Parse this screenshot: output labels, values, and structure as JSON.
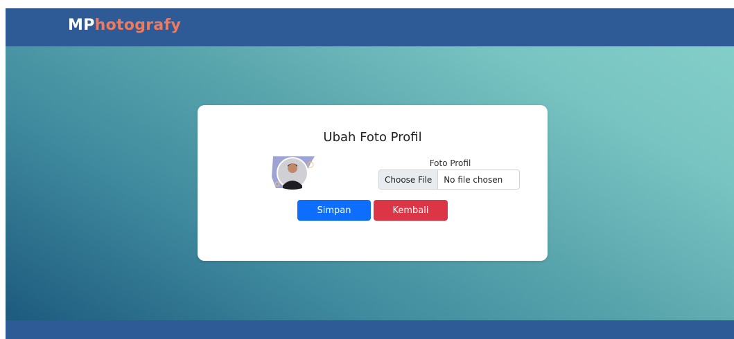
{
  "brand": {
    "part1": "MP",
    "part2": "hotografy"
  },
  "card": {
    "title": "Ubah Foto Profil",
    "field_label": "Foto Profil",
    "file_button": "Choose File",
    "file_status": "No file chosen",
    "save_label": "Simpan",
    "back_label": "Kembali"
  },
  "colors": {
    "navbar": "#2e5a96",
    "brand_accent": "#ef7a5d",
    "primary": "#0d6efd",
    "danger": "#dc3545"
  }
}
